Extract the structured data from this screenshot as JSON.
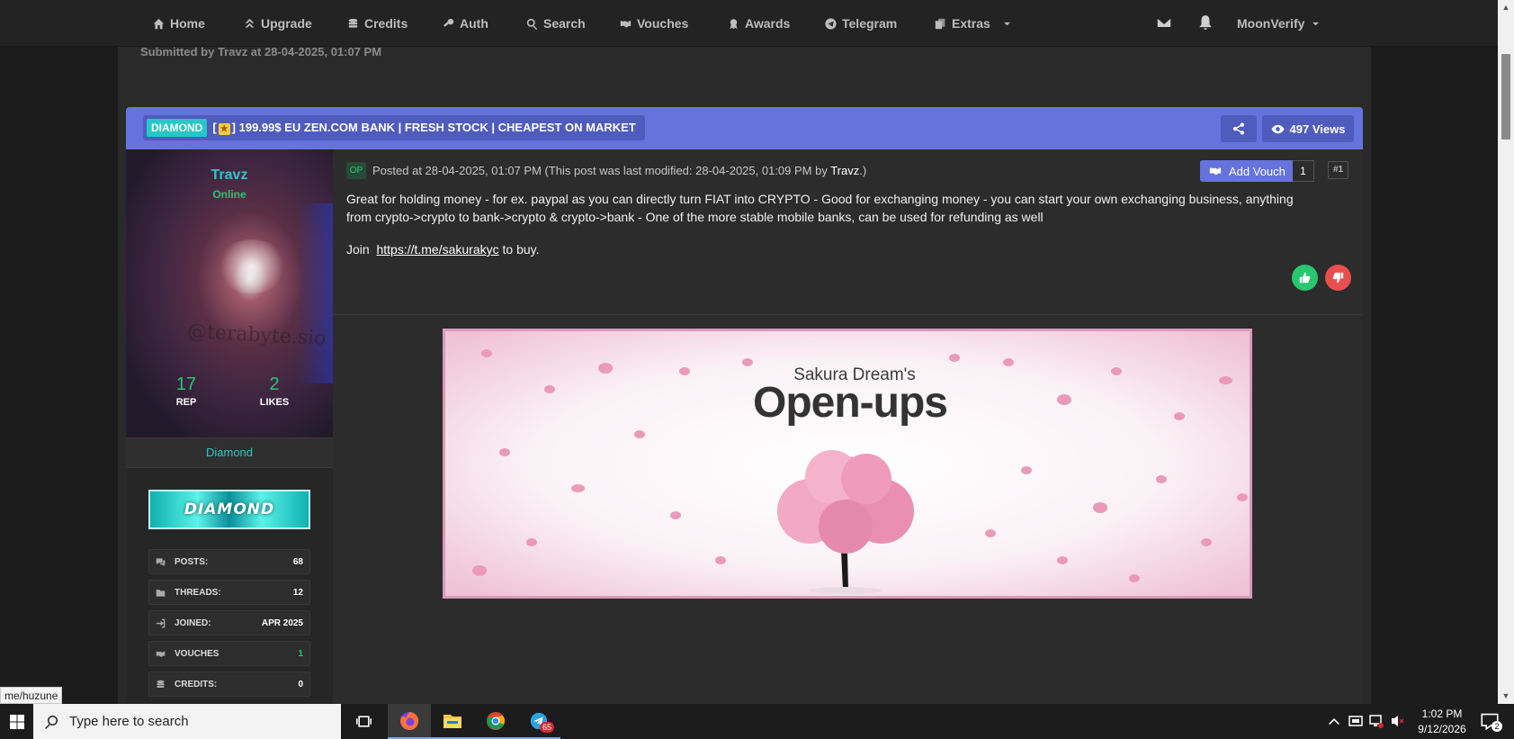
{
  "nav": {
    "items": [
      {
        "label": "Home",
        "icon": "home-icon"
      },
      {
        "label": "Upgrade",
        "icon": "upgrade-icon"
      },
      {
        "label": "Credits",
        "icon": "coins-icon"
      },
      {
        "label": "Auth",
        "icon": "key-icon"
      },
      {
        "label": "Search",
        "icon": "search-icon"
      },
      {
        "label": "Vouches",
        "icon": "handshake-icon"
      },
      {
        "label": "Awards",
        "icon": "award-icon"
      },
      {
        "label": "Telegram",
        "icon": "telegram-icon"
      },
      {
        "label": "Extras",
        "icon": "copy-icon"
      }
    ],
    "username": "MoonVerify"
  },
  "submitted": "Submitted by Travz at 28-04-2025, 01:07 PM",
  "thread": {
    "badge": "DIAMOND",
    "title_prefix": "[",
    "title_star": "★",
    "title_text": "] 199.99$ EU ZEN.COM BANK | FRESH STOCK | CHEAPEST ON MARKET",
    "views": "497 Views"
  },
  "user": {
    "name": "Travz",
    "status": "Online",
    "avatar_watermark": "@terabyte.sio",
    "rep": "17",
    "rep_label": "REP",
    "likes": "2",
    "likes_label": "LIKES",
    "rank": "Diamond",
    "rank_banner": "DIAMOND",
    "stats": [
      {
        "label": "POSTS:",
        "value": "68",
        "icon": "comments-icon"
      },
      {
        "label": "THREADS:",
        "value": "12",
        "icon": "folder-icon"
      },
      {
        "label": "JOINED:",
        "value": "APR 2025",
        "icon": "sign-in-icon"
      },
      {
        "label": "VOUCHES",
        "value": "1",
        "icon": "handshake-icon"
      },
      {
        "label": "CREDITS:",
        "value": "0",
        "icon": "coins-icon"
      }
    ]
  },
  "post": {
    "op": "OP",
    "meta_prefix": "Posted at 28-04-2025, 01:07 PM (This post was last modified: 28-04-2025, 01:09 PM by ",
    "meta_author": "Travz",
    "meta_suffix": ".)",
    "add_vouch": "Add Vouch",
    "vouch_count": "1",
    "post_number": "#1",
    "body": "Great for holding money - for ex. paypal as you can directly turn FIAT into CRYPTO - Good for exchanging money - you can start your own exchanging business, anything from crypto->crypto to bank->crypto & crypto->bank - One of the more stable mobile banks, can be used for refunding as well",
    "join_prefix": "Join",
    "join_link": "https://t.me/sakurakyc",
    "join_suffix": "to buy."
  },
  "banner": {
    "subtitle": "Sakura Dream's",
    "title": "Open-ups"
  },
  "status_url": "me/huzune",
  "taskbar": {
    "search_placeholder": "Type here to search",
    "telegram_badge": "65",
    "time": "1:02 PM",
    "date": "9/12/2026",
    "notification_count": "2"
  },
  "colors": {
    "accent": "#6673dd",
    "teal": "#27c9c9",
    "green": "#28c76f",
    "red": "#ea4e4e"
  }
}
